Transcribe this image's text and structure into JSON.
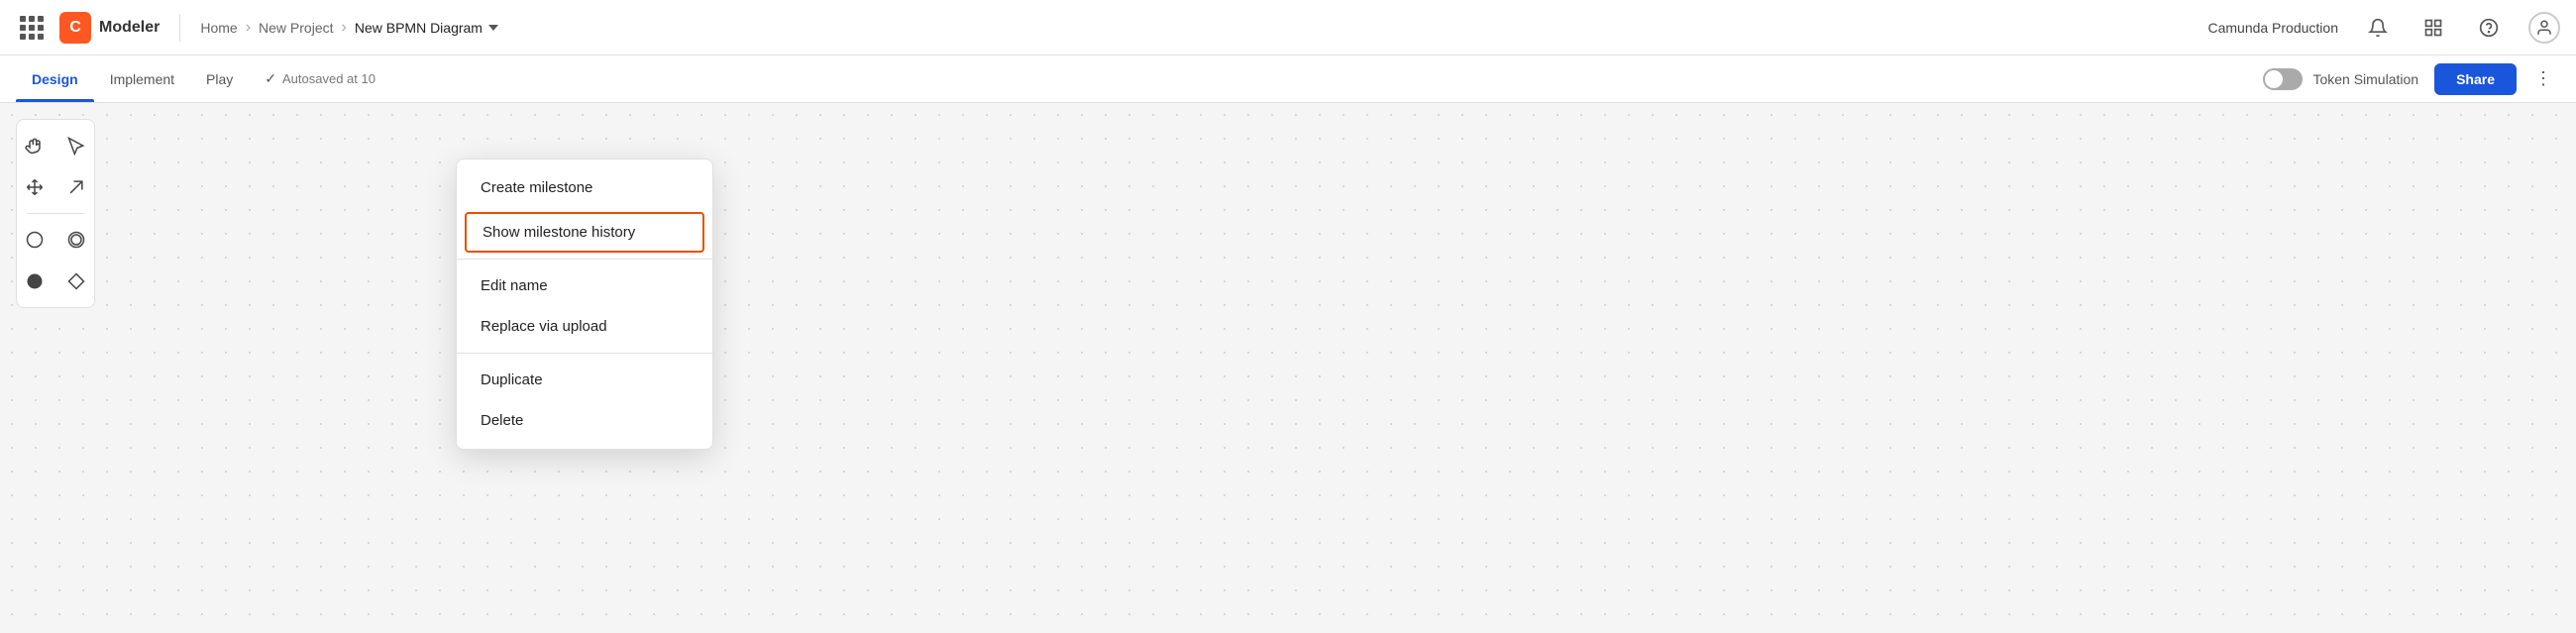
{
  "appBar": {
    "gridIcon": "grid-icon",
    "logo": "C",
    "appName": "Modeler",
    "breadcrumb": {
      "home": "Home",
      "project": "New Project",
      "current": "New BPMN Diagram"
    }
  },
  "navRight": {
    "envLabel": "Camunda Production",
    "bellIcon": "🔔",
    "buildingIcon": "⊞",
    "questionIcon": "?",
    "avatarIcon": "👤"
  },
  "tabs": {
    "items": [
      {
        "label": "Design",
        "active": true
      },
      {
        "label": "Implement",
        "active": false
      },
      {
        "label": "Play",
        "active": false
      }
    ],
    "autosave": "Autosaved at 10",
    "tokenSimulation": "Token Simulation",
    "shareLabel": "Share",
    "moreIcon": "⋮"
  },
  "toolbar": {
    "tools": [
      {
        "icon": "✋",
        "name": "hand-tool"
      },
      {
        "icon": "⊹",
        "name": "select-tool"
      },
      {
        "icon": "⇹",
        "name": "pan-tool"
      },
      {
        "icon": "↗",
        "name": "arrow-tool"
      },
      {
        "icon": "○",
        "name": "circle-tool"
      },
      {
        "icon": "◎",
        "name": "circle-outline-tool"
      },
      {
        "icon": "●",
        "name": "filled-circle-tool"
      },
      {
        "icon": "◇",
        "name": "diamond-tool"
      }
    ]
  },
  "dropdownMenu": {
    "items": [
      {
        "label": "Create milestone",
        "highlighted": false
      },
      {
        "label": "Show milestone history",
        "highlighted": true
      },
      {
        "label": "Edit name",
        "highlighted": false
      },
      {
        "label": "Replace via upload",
        "highlighted": false
      },
      {
        "label": "Duplicate",
        "highlighted": false
      },
      {
        "label": "Delete",
        "highlighted": false
      }
    ]
  }
}
